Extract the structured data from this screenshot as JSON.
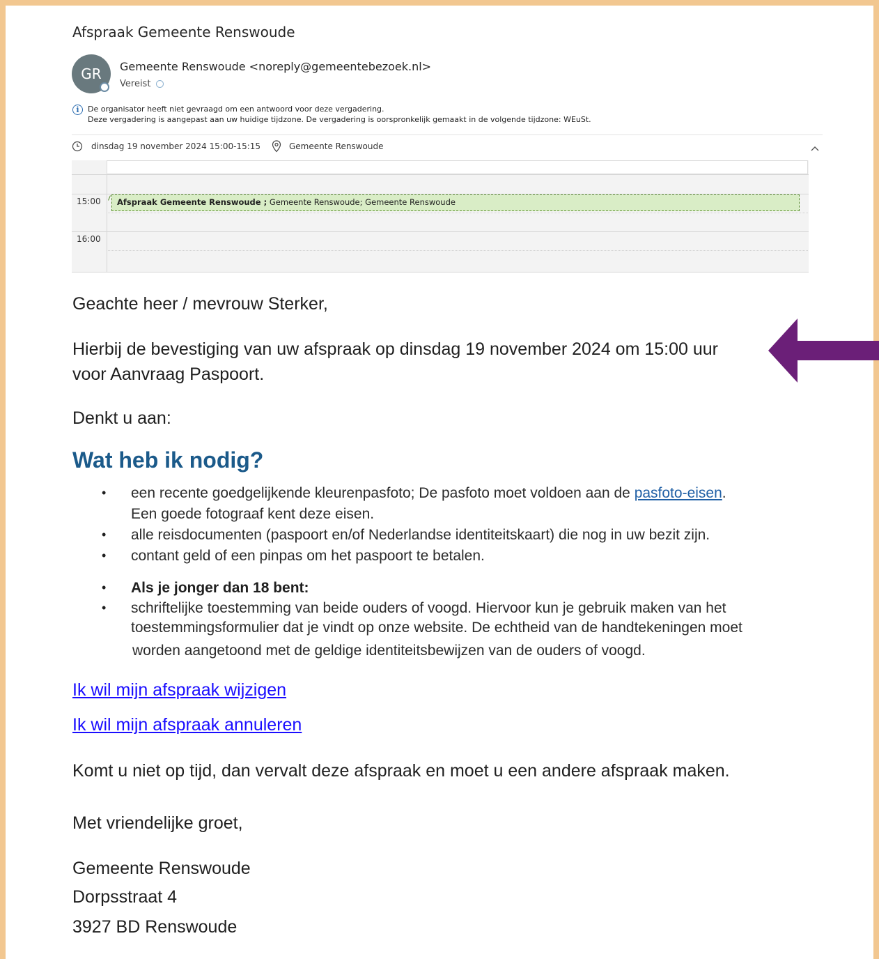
{
  "email": {
    "subject": "Afspraak Gemeente Renswoude",
    "avatar_initials": "GR",
    "sender": "Gemeente Renswoude <noreply@gemeentebezoek.nl>",
    "attendance": "Vereist",
    "info_line1": "De organisator heeft niet gevraagd om een antwoord voor deze vergadering.",
    "info_line2": "Deze vergadering is aangepast aan uw huidige tijdzone. De vergadering is oorspronkelijk gemaakt in de volgende tijdzone: WEuSt.",
    "datetime": "dinsdag 19 november 2024 15:00-15:15",
    "location": "Gemeente Renswoude"
  },
  "calendar": {
    "time_15": "15:00",
    "time_16": "16:00",
    "event_title": "Afspraak Gemeente Renswoude ;",
    "event_rest": " Gemeente Renswoude; Gemeente Renswoude"
  },
  "body": {
    "greeting": "Geachte heer / mevrouw Sterker,",
    "confirm_line1": "Hierbij de bevestiging van uw afspraak op dinsdag 19 november 2024 om 15:00 uur",
    "confirm_line2": "voor Aanvraag Paspoort.",
    "reminder": "Denkt u aan:",
    "heading": "Wat heb ik nodig?",
    "item1_text": "een recente goedgelijkende kleurenpasfoto; De pasfoto moet voldoen aan de ",
    "item1_link": "pasfoto-eisen",
    "item1_end": ".",
    "item1_line2": "Een goede fotograaf kent deze eisen.",
    "item2": "alle reisdocumenten (paspoort en/of Nederlandse identiteitskaart) die nog in uw bezit zijn.",
    "item3": "contant geld of een pinpas om het paspoort te betalen.",
    "item4": "Als je jonger dan 18 bent:",
    "item5_line1": "schriftelijke toestemming van beide ouders of voogd. Hiervoor kun je gebruik maken van het",
    "item5_line2": "toestemmingsformulier dat je vindt op onze website. De echtheid van de handtekeningen moet",
    "item5_line3": "worden aangetoond met de geldige identiteitsbewijzen van de ouders of voogd.",
    "link_change": "Ik wil mijn afspraak wijzigen",
    "link_cancel": "Ik wil mijn afspraak annuleren",
    "late_notice": "Komt u niet op tijd, dan vervalt deze afspraak en moet u een andere afspraak maken.",
    "closing": "Met vriendelijke groet,",
    "org_name": "Gemeente Renswoude",
    "org_street": "Dorpsstraat 4",
    "org_city": "3927 BD Renswoude"
  },
  "colors": {
    "frame": "#f2c790",
    "heading": "#1b5a8a",
    "link": "#1a0dff",
    "event_fill": "#d9edc6",
    "arrow": "#6b1f78"
  }
}
